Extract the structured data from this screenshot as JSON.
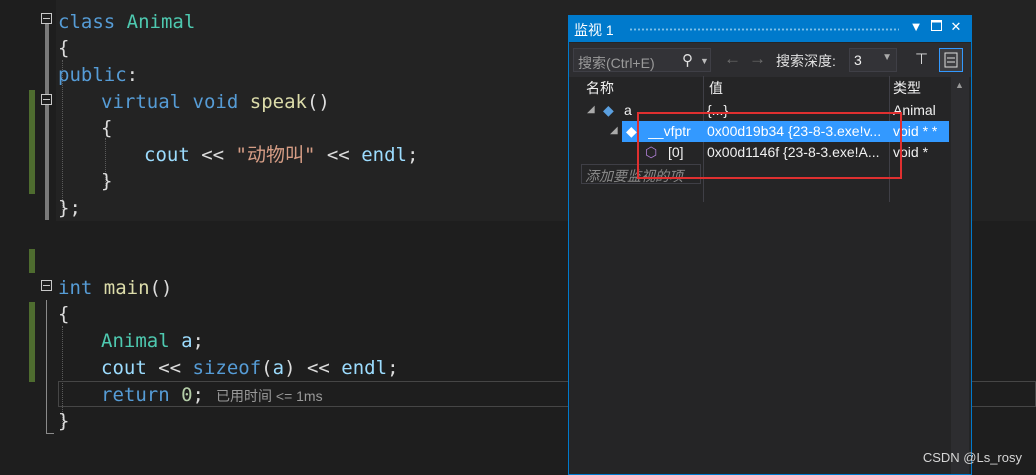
{
  "code": {
    "l1_kw": "class",
    "l1_name": "Animal",
    "l2": "{",
    "l3_kw": "public",
    "l3_colon": ":",
    "l4_kw1": "virtual",
    "l4_kw2": "void",
    "l4_fn": "speak",
    "l4_paren": "()",
    "l5": "{",
    "l6_id": "cout",
    "l6_op": " << ",
    "l6_str": "\"动物叫\"",
    "l6_op2": " << ",
    "l6_endl": "endl",
    "l6_semi": ";",
    "l7": "}",
    "l8": "};",
    "l9_kw": "int",
    "l9_fn": "main",
    "l9_paren": "()",
    "l10": "{",
    "l11_ty": "Animal",
    "l11_id": " a",
    "l11_semi": ";",
    "l12_id": "cout",
    "l12_op": " << ",
    "l12_kw": "sizeof",
    "l12_p1": "(",
    "l12_a": "a",
    "l12_p2": ")",
    "l12_op2": " << ",
    "l12_endl": "endl",
    "l12_semi": ";",
    "l13_kw": "return",
    "l13_num": " 0",
    "l13_semi": ";",
    "l14": "}",
    "perf_tip": "已用时间 <= 1ms"
  },
  "watch": {
    "title": "监视 1",
    "search_placeholder": "搜索(Ctrl+E)",
    "depth_label": "搜索深度:",
    "depth_value": "3",
    "col_name": "名称",
    "col_value": "值",
    "col_type": "类型",
    "rows": [
      {
        "name": "a",
        "value": "{...}",
        "type": "Animal"
      },
      {
        "name": "__vfptr",
        "value": "0x00d19b34 {23-8-3.exe!v...",
        "type": "void * *"
      },
      {
        "name": "[0]",
        "value": "0x00d1146f {23-8-3.exe!A...",
        "type": "void *"
      }
    ],
    "add_item": "添加要监视的项"
  },
  "watermark": "CSDN @Ls_rosy",
  "colors": {
    "accent": "#007acc",
    "selection": "#3399ff",
    "highlight_box": "#e03030",
    "change_bar": "#4e6c2f"
  }
}
